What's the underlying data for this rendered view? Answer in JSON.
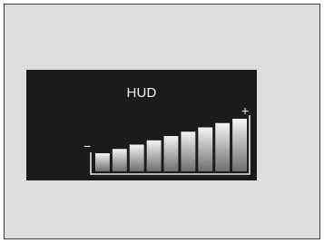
{
  "hud": {
    "title": "HUD",
    "decrease_label": "−",
    "increase_label": "+",
    "total_levels": 9,
    "current_level": 9,
    "colors": {
      "panel_background": "#1b1b1b",
      "outer_background": "#dedede",
      "text": "#f2f2f2",
      "bar_gradient_top": "#f4f4f4",
      "bar_gradient_bottom": "#6e6e6e"
    }
  }
}
